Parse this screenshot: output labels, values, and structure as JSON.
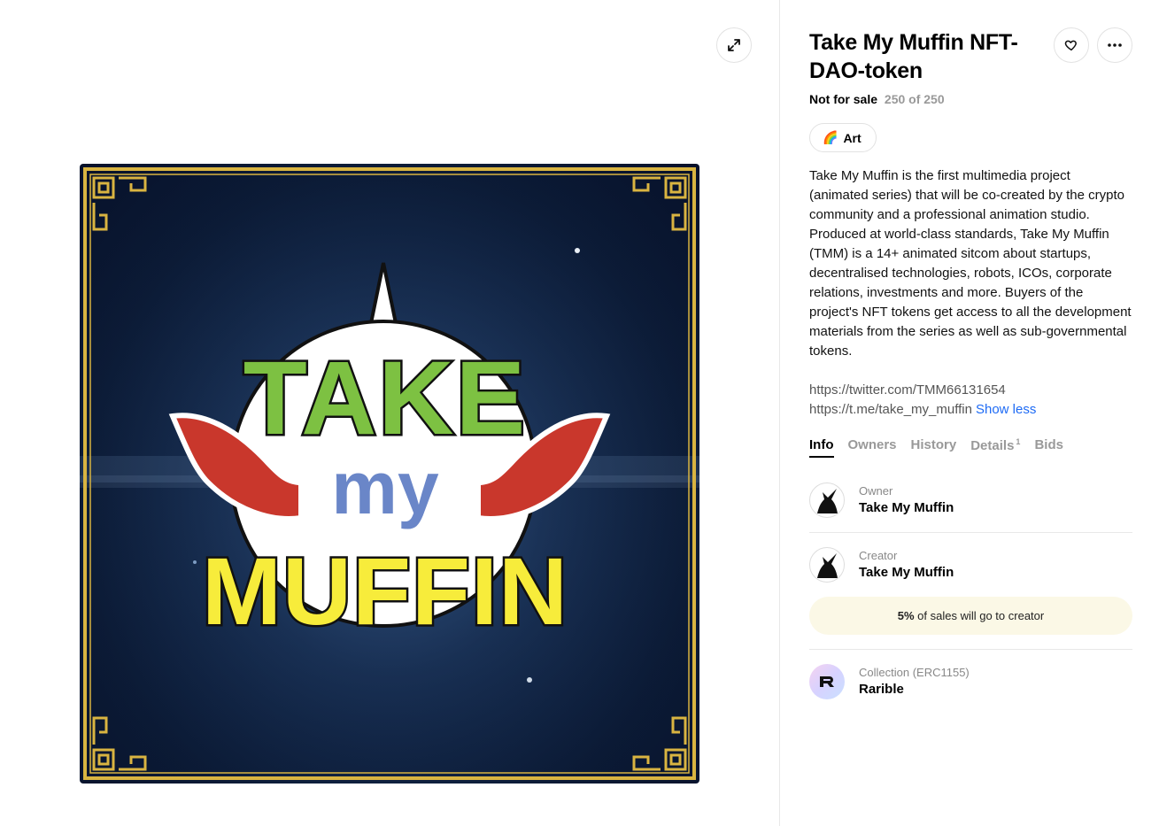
{
  "item": {
    "title": "Take My Muffin NFT-DAO-token",
    "sale_status": "Not for sale",
    "edition": "250 of 250",
    "tag": {
      "emoji": "🌈",
      "label": "Art"
    },
    "description": "Take My Muffin is the first multimedia project (animated series) that will be co-created by the crypto community and a professional animation studio. Produced at world-class standards, Take My Muffin (TMM) is a 14+ animated sitcom about startups, decentralised technologies, robots, ICOs, corporate relations, investments and more. Buyers of the project's NFT tokens get access to all the development materials from the series as well as sub-governmental tokens.",
    "links": [
      "https://twitter.com/TMM66131654",
      "https://t.me/take_my_muffin"
    ],
    "show_less_label": "Show less"
  },
  "artwork": {
    "line1": "TAKE",
    "line2": "my",
    "line3": "MUFFIN"
  },
  "tabs": [
    {
      "label": "Info",
      "active": true
    },
    {
      "label": "Owners",
      "active": false
    },
    {
      "label": "History",
      "active": false
    },
    {
      "label": "Details",
      "badge": "1",
      "active": false
    },
    {
      "label": "Bids",
      "active": false
    }
  ],
  "owner": {
    "role": "Owner",
    "name": "Take My Muffin"
  },
  "creator": {
    "role": "Creator",
    "name": "Take My Muffin"
  },
  "royalty": {
    "percent": "5%",
    "text": " of sales will go to creator"
  },
  "collection": {
    "role": "Collection (ERC1155)",
    "name": "Rarible"
  },
  "colors": {
    "link_blue": "#1e6bf5",
    "royalty_bg": "#fbf8e6",
    "art_bg": "#0b1a35",
    "logo_green": "#7dc142",
    "logo_blue": "#6a86c8",
    "logo_yellow": "#f7ec3b",
    "logo_red": "#c9372c",
    "frame_gold": "#d9b441"
  },
  "icons": {
    "expand": "expand-arrows-icon",
    "like": "heart-icon",
    "more": "more-dots-icon",
    "avatar": "unicorn-avatar-icon",
    "collection": "rarible-logo-icon"
  }
}
